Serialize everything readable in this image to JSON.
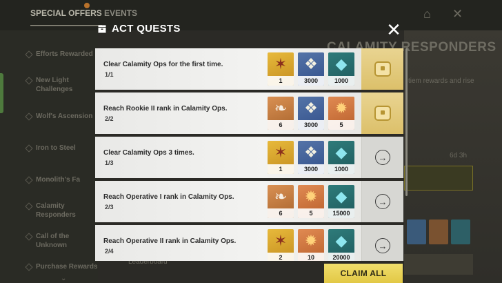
{
  "background": {
    "tabs": [
      "SPECIAL OFFERS",
      "EVENTS"
    ],
    "sidebar_items": [
      "Efforts Rewarded",
      "New Light Challenges",
      "Wolf's Ascension",
      "Iron to Steel",
      "Monolith's Fa",
      "Calamity Responders",
      "Call of the Unknown",
      "Purchase Rewards"
    ],
    "event_title": "CALAMITY RESPONDERS",
    "event_sub": "tiem rewards and rise",
    "timer": "6d 3h",
    "leaderboard": "Leaderboard"
  },
  "modal": {
    "title": "ACT QUESTS",
    "close_glyph": "✕",
    "claim_all_label": "CLAIM ALL"
  },
  "quests": [
    {
      "title": "Clear Calamity Ops for the first time.",
      "progress": "1/1",
      "state": "claim",
      "rewards": [
        {
          "icon": "star-badge-icon",
          "color": "gold",
          "qty": "1"
        },
        {
          "icon": "wing-emblem-icon",
          "color": "blue",
          "qty": "3000"
        },
        {
          "icon": "crystal-cube-icon",
          "color": "teal",
          "qty": "1000"
        }
      ]
    },
    {
      "title": "Reach Rookie II rank in Calamity Ops.",
      "progress": "2/2",
      "state": "claim",
      "rewards": [
        {
          "icon": "feather-icon",
          "color": "brown",
          "qty": "6"
        },
        {
          "icon": "wing-emblem-icon",
          "color": "blue",
          "qty": "3000"
        },
        {
          "icon": "flame-badge-icon",
          "color": "orange",
          "qty": "5"
        }
      ]
    },
    {
      "title": "Clear Calamity Ops 3 times.",
      "progress": "1/3",
      "state": "go",
      "rewards": [
        {
          "icon": "star-badge-icon",
          "color": "gold",
          "qty": "1"
        },
        {
          "icon": "wing-emblem-icon",
          "color": "blue",
          "qty": "3000"
        },
        {
          "icon": "crystal-cube-icon",
          "color": "teal",
          "qty": "1000"
        }
      ]
    },
    {
      "title": "Reach Operative I rank in Calamity Ops.",
      "progress": "2/3",
      "state": "go",
      "rewards": [
        {
          "icon": "feather-icon",
          "color": "brown",
          "qty": "6"
        },
        {
          "icon": "flame-badge-icon",
          "color": "orange",
          "qty": "5"
        },
        {
          "icon": "crystal-cube-icon",
          "color": "teal",
          "qty": "15000"
        }
      ]
    },
    {
      "title": "Reach Operative II rank in Calamity Ops.",
      "progress": "2/4",
      "state": "go",
      "rewards": [
        {
          "icon": "star-badge-icon",
          "color": "gold",
          "qty": "2"
        },
        {
          "icon": "flame-badge-icon",
          "color": "orange",
          "qty": "10"
        },
        {
          "icon": "crystal-cube-icon",
          "color": "teal",
          "qty": "20000"
        }
      ]
    }
  ]
}
